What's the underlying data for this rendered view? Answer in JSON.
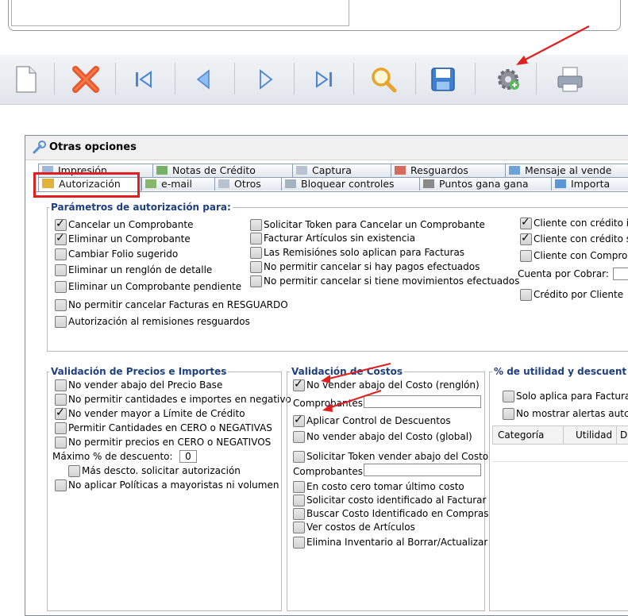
{
  "dialog": {
    "title": "Otras opciones",
    "tabs_row1": [
      "Impresión",
      "Notas de Crédito",
      "Captura",
      "Resguardos",
      "Mensaje al vende"
    ],
    "tabs_row2": [
      "Autorización",
      "e-mail",
      "Otros",
      "Bloquear controles",
      "Puntos gana gana",
      "Importa"
    ]
  },
  "autorizacion": {
    "title": "Parámetros de autorización para:",
    "col1": [
      {
        "label": "Cancelar un Comprobante",
        "checked": true
      },
      {
        "label": "Eliminar un Comprobante",
        "checked": true
      },
      {
        "label": "Cambiar Folio sugerido",
        "checked": false
      },
      {
        "label": "Eliminar un renglón de detalle",
        "checked": false
      },
      {
        "label": "Eliminar un Comprobante pendiente",
        "checked": false
      },
      {
        "label": "No permitir cancelar Facturas en RESGUARDO",
        "checked": false
      },
      {
        "label": "Autorización al remisiones resguardos",
        "checked": false
      }
    ],
    "col2": [
      {
        "label": "Solicitar Token para Cancelar un Comprobante",
        "checked": false
      },
      {
        "label": "Facturar Artículos sin existencia",
        "checked": false
      },
      {
        "label": "Las Remisiónes solo aplican para Facturas",
        "checked": false
      },
      {
        "label": "No permitir cancelar si hay pagos efectuados",
        "checked": false
      },
      {
        "label": "No permitir cancelar si tiene movimientos efectuados",
        "checked": false
      }
    ],
    "col3": [
      {
        "label": "Cliente con crédito i",
        "checked": true
      },
      {
        "label": "Cliente con crédito s",
        "checked": true
      },
      {
        "label": "Cliente con Comprol",
        "checked": false
      }
    ],
    "cuenta_label": "Cuenta por Cobrar:",
    "credito_cliente": {
      "label": "Crédito por Cliente",
      "checked": false
    }
  },
  "precios": {
    "title": "Validación de Precios e Importes",
    "options": [
      {
        "label": "No vender abajo del Precio Base",
        "checked": false
      },
      {
        "label": "No permitir cantidades e importes en negativo",
        "checked": false
      },
      {
        "label": "No vender mayor a Límite de Crédito",
        "checked": true
      },
      {
        "label": "Permitir Cantidades en CERO o NEGATIVAS",
        "checked": false
      },
      {
        "label": "No permitir precios en CERO o NEGATIVOS",
        "checked": false
      }
    ],
    "max_descuento_label": "Máximo % de descuento:",
    "max_descuento_value": "0",
    "mas_descto": {
      "label": "Más descto. solicitar autorización",
      "checked": false
    },
    "no_aplicar": {
      "label": "No aplicar Políticas a mayoristas ni volumen",
      "checked": false
    }
  },
  "costos": {
    "title": "Validación de Costos",
    "no_vender_renglon": {
      "label": "No vender abajo del Costo (renglón)",
      "checked": true
    },
    "comprobantes_label": "Comprobantes:",
    "aplicar_descuentos": {
      "label": "Aplicar Control de Descuentos",
      "checked": true
    },
    "no_vender_global": {
      "label": "No vender abajo del Costo (global)",
      "checked": false
    },
    "solicitar_token": {
      "label": "Solicitar Token vender abajo del Costo",
      "checked": false
    },
    "comprobantes2_label": "Comprobantes:",
    "rest": [
      {
        "label": "En costo cero tomar último costo",
        "checked": false
      },
      {
        "label": "Solicitar costo identificado al Facturar",
        "checked": false
      },
      {
        "label": "Buscar Costo Identificado en Compras",
        "checked": false
      },
      {
        "label": "Ver costos de Artículos",
        "checked": false
      },
      {
        "label": "Elimina Inventario al Borrar/Actualizar",
        "checked": false
      }
    ]
  },
  "utilidad": {
    "title": "% de utilidad y descuent",
    "solo_aplica": {
      "label": "Solo aplica para Factura",
      "checked": false
    },
    "no_mostrar": {
      "label": "No mostrar alertas autc",
      "checked": false
    },
    "columns": [
      "Categoría",
      "Utilidad",
      "D"
    ]
  },
  "colors": {
    "accent_red": "#e02020",
    "group_title": "#1f3f7f"
  }
}
